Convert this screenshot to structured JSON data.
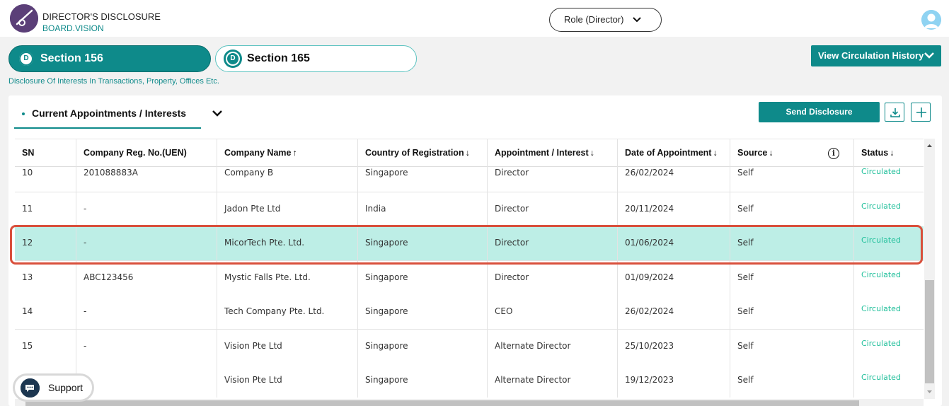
{
  "header": {
    "title": "DIRECTOR'S DISCLOSURE",
    "subtitle": "BOARD.VISION",
    "role_label": "Role (Director)"
  },
  "sections": {
    "tabs": [
      {
        "badge": "D",
        "label": "Section 156"
      },
      {
        "badge": "D",
        "label": "Section 165"
      }
    ],
    "description": "Disclosure Of Interests In Transactions, Property, Offices Etc.",
    "view_history_label": "View Circulation History"
  },
  "panel": {
    "tab_label": "Current Appointments / Interests",
    "send_label": "Send Disclosure"
  },
  "table": {
    "columns": [
      "SN",
      "Company Reg. No.(UEN)",
      "Company Name",
      "Country of Registration",
      "Appointment / Interest",
      "Date of Appointment",
      "Source",
      "Status"
    ],
    "sort_arrows": [
      "",
      "",
      "↑",
      "↓",
      "↓",
      "↓",
      "↓",
      "↓"
    ],
    "rows": [
      {
        "sn": "10",
        "uen": "201088883A",
        "company": "Company B",
        "country": "Singapore",
        "appointment": "Director",
        "date": "26/02/2024",
        "source": "Self",
        "status": "Circulated"
      },
      {
        "sn": "11",
        "uen": "-",
        "company": "Jadon Pte Ltd",
        "country": "India",
        "appointment": "Director",
        "date": "20/11/2024",
        "source": "Self",
        "status": "Circulated"
      },
      {
        "sn": "12",
        "uen": "-",
        "company": "MicorTech Pte. Ltd.",
        "country": "Singapore",
        "appointment": "Director",
        "date": "01/06/2024",
        "source": "Self",
        "status": "Circulated"
      },
      {
        "sn": "13",
        "uen": "ABC123456",
        "company": "Mystic Falls Pte. Ltd.",
        "country": "Singapore",
        "appointment": "Director",
        "date": "01/09/2024",
        "source": "Self",
        "status": "Circulated"
      },
      {
        "sn": "14",
        "uen": "-",
        "company": "Tech Company Pte. Ltd.",
        "country": "Singapore",
        "appointment": "CEO",
        "date": "26/02/2024",
        "source": "Self",
        "status": "Circulated"
      },
      {
        "sn": "15",
        "uen": "-",
        "company": "Vision Pte Ltd",
        "country": "Singapore",
        "appointment": "Alternate Director",
        "date": "25/10/2023",
        "source": "Self",
        "status": "Circulated"
      },
      {
        "sn": "",
        "uen": "",
        "company": "Vision Pte Ltd",
        "country": "Singapore",
        "appointment": "Alternate Director",
        "date": "19/12/2023",
        "source": "Self",
        "status": "Circulated"
      }
    ]
  },
  "support_label": "Support",
  "colors": {
    "accent": "#0e8a8a",
    "highlight_row": "#bdeee6",
    "highlight_border": "#d9503c",
    "status_green": "#1fbf9a"
  }
}
